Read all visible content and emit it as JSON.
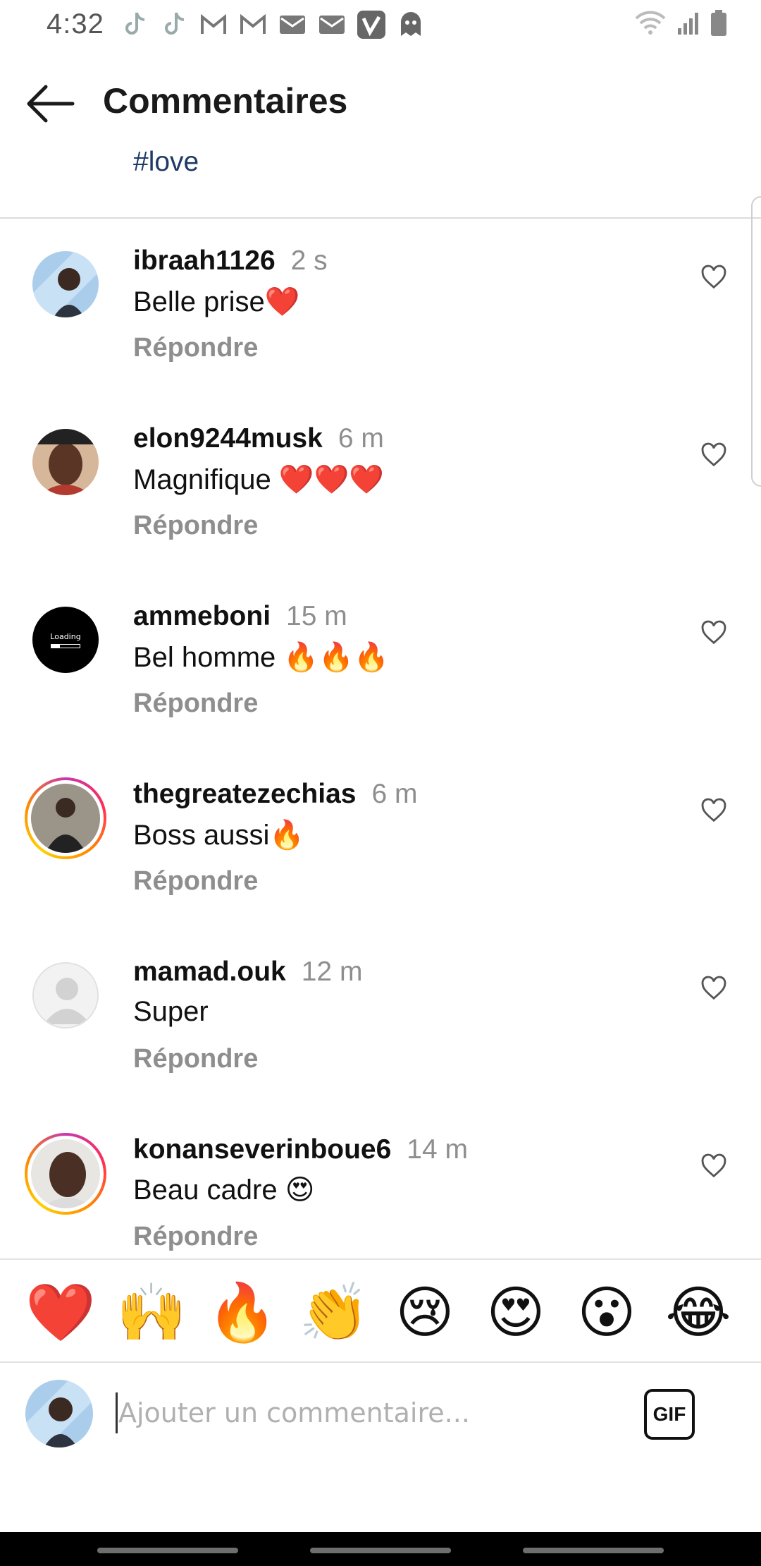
{
  "status_bar": {
    "time": "4:32",
    "notification_icons": [
      "tiktok-icon",
      "tiktok-icon",
      "gmail-icon",
      "gmail-icon",
      "mail-icon",
      "mail-icon",
      "vimeo-icon",
      "ghost-icon"
    ],
    "system_icons": [
      "wifi-icon",
      "signal-icon",
      "battery-icon"
    ]
  },
  "header": {
    "title": "Commentaires",
    "hashtag": "#love"
  },
  "comments": [
    {
      "username": "ibraah1126",
      "time": "2 s",
      "text": "Belle prise❤️",
      "reply": "Répondre"
    },
    {
      "username": "elon9244musk",
      "time": "6 m",
      "text": "Magnifique ❤️❤️❤️",
      "reply": "Répondre"
    },
    {
      "username": "ammeboni",
      "time": "15 m",
      "text": "Bel homme 🔥🔥🔥",
      "reply": "Répondre",
      "avatar_text": "Loading"
    },
    {
      "username": "thegreatezechias",
      "time": "6 m",
      "text": "Boss aussi🔥",
      "reply": "Répondre"
    },
    {
      "username": "mamad.ouk",
      "time": "12 m",
      "text": "Super",
      "reply": "Répondre"
    },
    {
      "username": "konanseverinboue6",
      "time": "14 m",
      "text": "Beau cadre 😍",
      "reply": "Répondre"
    }
  ],
  "emoji_bar": [
    "❤️",
    "🙌",
    "🔥",
    "👏",
    "😢",
    "😍",
    "😮",
    "😂"
  ],
  "composer": {
    "placeholder": "Ajouter un commentaire...",
    "value": "",
    "gif_label": "GIF"
  },
  "colors": {
    "hashtag": "#1f3a66",
    "secondary_text": "#8e8e8e",
    "divider": "#dbdbdb"
  }
}
